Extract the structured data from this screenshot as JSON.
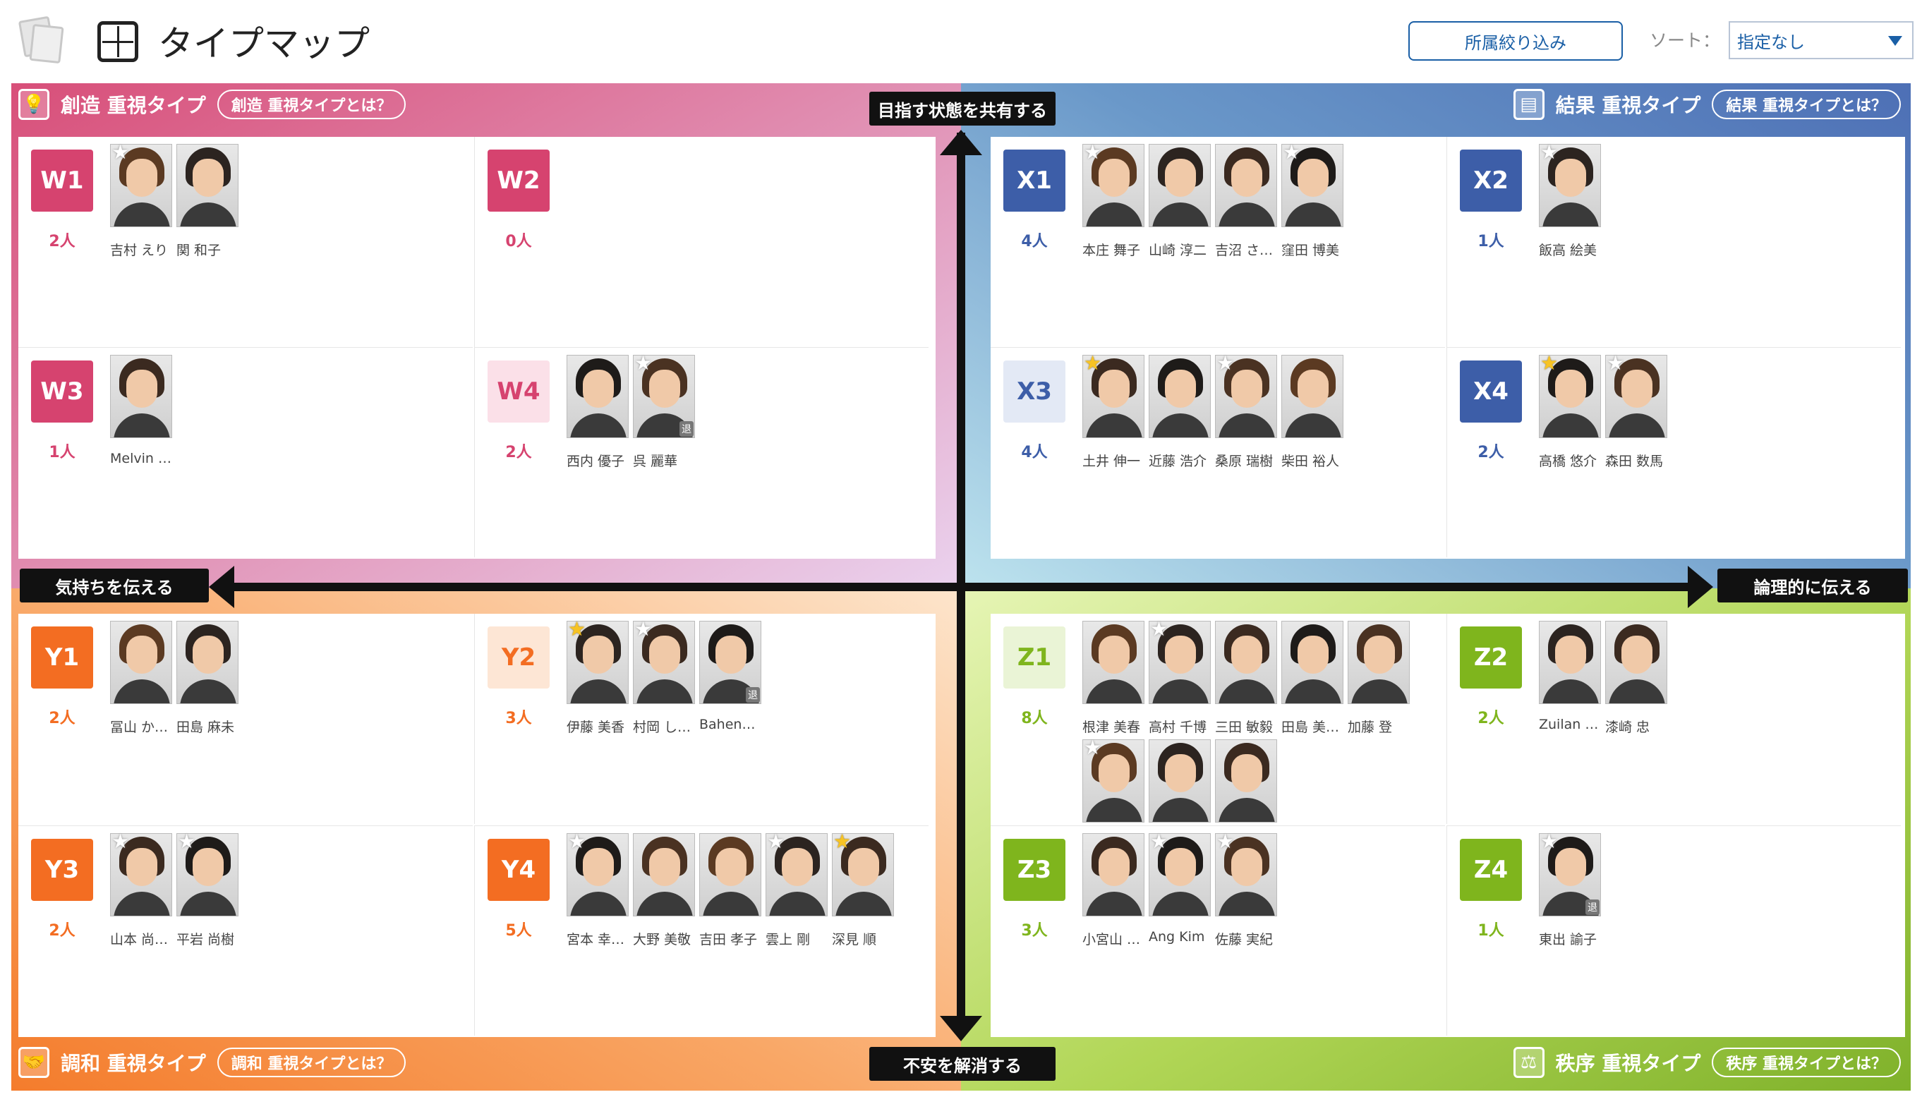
{
  "header": {
    "title": "タイプマップ",
    "filter_label": "所属絞り込み",
    "sort_label": "ソート：",
    "sort_value": "指定なし"
  },
  "axes": {
    "top": "目指す状態を共有する",
    "bottom": "不安を解消する",
    "left": "気持ちを伝える",
    "right": "論理的に伝える"
  },
  "colors": {
    "w": "#d6436f",
    "x": "#3d5ea8",
    "y": "#f36d22",
    "z": "#7fb51d"
  },
  "quadrants": {
    "w": {
      "title": "創造 重視タイプ",
      "about": "創造 重視タイプとは？",
      "icon": "lightbulb-icon"
    },
    "x": {
      "title": "結果 重視タイプ",
      "about": "結果 重視タイプとは？",
      "icon": "chart-icon"
    },
    "y": {
      "title": "調和 重視タイプ",
      "about": "調和 重視タイプとは？",
      "icon": "handshake-icon"
    },
    "z": {
      "title": "秩序 重視タイプ",
      "about": "秩序 重視タイプとは？",
      "icon": "scale-icon"
    }
  },
  "cells": {
    "W1": {
      "code": "W1",
      "count": "2人",
      "people": [
        {
          "name": "吉村 えり",
          "star": "white"
        },
        {
          "name": "関 和子",
          "star": ""
        }
      ]
    },
    "W2": {
      "code": "W2",
      "count": "0人",
      "people": []
    },
    "W3": {
      "code": "W3",
      "count": "1人",
      "people": [
        {
          "name": "Melvin …",
          "star": ""
        }
      ]
    },
    "W4": {
      "code": "W4",
      "count": "2人",
      "people": [
        {
          "name": "西内 優子",
          "star": ""
        },
        {
          "name": "呉 麗華",
          "star": "white",
          "retired": "退"
        }
      ]
    },
    "X1": {
      "code": "X1",
      "count": "4人",
      "people": [
        {
          "name": "本庄 舞子",
          "star": "white"
        },
        {
          "name": "山崎 淳二",
          "star": ""
        },
        {
          "name": "吉沼 さ…",
          "star": ""
        },
        {
          "name": "窪田 博美",
          "star": "white"
        }
      ]
    },
    "X2": {
      "code": "X2",
      "count": "1人",
      "people": [
        {
          "name": "飯高 絵美",
          "star": "white"
        }
      ]
    },
    "X3": {
      "code": "X3",
      "count": "4人",
      "people": [
        {
          "name": "土井 伸一",
          "star": "gold"
        },
        {
          "name": "近藤 浩介",
          "star": ""
        },
        {
          "name": "桑原 瑞樹",
          "star": "white"
        },
        {
          "name": "柴田 裕人",
          "star": ""
        }
      ]
    },
    "X4": {
      "code": "X4",
      "count": "2人",
      "people": [
        {
          "name": "高橋 悠介",
          "star": "gold"
        },
        {
          "name": "森田 数馬",
          "star": "white"
        }
      ]
    },
    "Y1": {
      "code": "Y1",
      "count": "2人",
      "people": [
        {
          "name": "冨山 か…",
          "star": ""
        },
        {
          "name": "田島 麻未",
          "star": ""
        }
      ]
    },
    "Y2": {
      "code": "Y2",
      "count": "3人",
      "people": [
        {
          "name": "伊藤 美香",
          "star": "gold"
        },
        {
          "name": "村岡 し…",
          "star": "white"
        },
        {
          "name": "Bahen…",
          "star": "",
          "retired": "退"
        }
      ]
    },
    "Y3": {
      "code": "Y3",
      "count": "2人",
      "people": [
        {
          "name": "山本 尚…",
          "star": "white"
        },
        {
          "name": "平岩 尚樹",
          "star": "white"
        }
      ]
    },
    "Y4": {
      "code": "Y4",
      "count": "5人",
      "people": [
        {
          "name": "宮本 幸…",
          "star": "white"
        },
        {
          "name": "大野 美敬",
          "star": ""
        },
        {
          "name": "吉田 孝子",
          "star": ""
        },
        {
          "name": "雲上 剛",
          "star": "white"
        },
        {
          "name": "深見 順",
          "star": "gold"
        }
      ]
    },
    "Z1": {
      "code": "Z1",
      "count": "8人",
      "people": [
        {
          "name": "根津 美春",
          "star": ""
        },
        {
          "name": "高村 千博",
          "star": "white"
        },
        {
          "name": "三田 敏毅",
          "star": ""
        },
        {
          "name": "田島 美…",
          "star": ""
        },
        {
          "name": "加藤 登",
          "star": ""
        },
        {
          "name": "",
          "star": "white"
        },
        {
          "name": "",
          "star": ""
        },
        {
          "name": "",
          "star": ""
        }
      ]
    },
    "Z2": {
      "code": "Z2",
      "count": "2人",
      "people": [
        {
          "name": "Zuilan …",
          "star": ""
        },
        {
          "name": "漆崎 忠",
          "star": ""
        }
      ]
    },
    "Z3": {
      "code": "Z3",
      "count": "3人",
      "people": [
        {
          "name": "小宮山 …",
          "star": ""
        },
        {
          "name": "Ang Kim",
          "star": "white"
        },
        {
          "name": "佐藤 実紀",
          "star": "white"
        }
      ]
    },
    "Z4": {
      "code": "Z4",
      "count": "1人",
      "people": [
        {
          "name": "東出 諭子",
          "star": "white",
          "retired": "退"
        }
      ]
    }
  }
}
